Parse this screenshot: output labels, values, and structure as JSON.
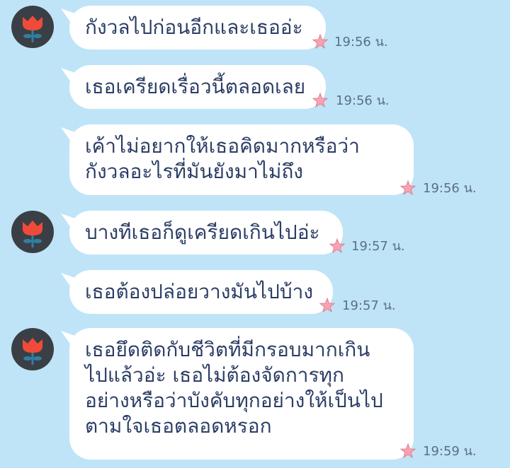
{
  "chat": {
    "messages": [
      {
        "text": [
          "กังวลไปก่อนอีกและเธออ่ะ"
        ],
        "time": "19:56 น.",
        "avatar": true
      },
      {
        "text": [
          "เธอเครียดเรื่อวนี้ตลอดเลย"
        ],
        "time": "19:56 น.",
        "avatar": false
      },
      {
        "text": [
          "เค้าไม่อยากให้เธอคิดมากหรือว่า",
          "กังวลอะไรที่มันยังมาไม่ถึง"
        ],
        "time": "19:56 น.",
        "avatar": false
      },
      {
        "text": [
          "บางทีเธอก็ดูเครียดเกินไปอ่ะ"
        ],
        "time": "19:57 น.",
        "avatar": true
      },
      {
        "text": [
          "เธอต้องปล่อยวางมันไปบ้าง"
        ],
        "time": "19:57 น.",
        "avatar": false
      },
      {
        "text": [
          "เธอยึดติดกับชีวิตที่มีกรอบมากเกิน",
          "ไปแล้วอ่ะ เธอไม่ต้องจัดการทุก",
          "อย่างหรือว่าบังคับทุกอย่างให้เป็นไป",
          "ตามใจเธอตลอดหรอก"
        ],
        "time": "19:59 น.",
        "avatar": true
      }
    ]
  },
  "colors": {
    "background": "#bfe4f7",
    "bubble": "#ffffff",
    "text": "#2c3e66",
    "time": "#5b6f8a",
    "avatar_bg": "#3a3f46",
    "flower": "#f04b3a",
    "stem": "#2f7fa3",
    "star": "#f7a3b0"
  },
  "icons": {
    "avatar": "red-tulip-flower-icon",
    "reaction": "pink-star-icon"
  }
}
